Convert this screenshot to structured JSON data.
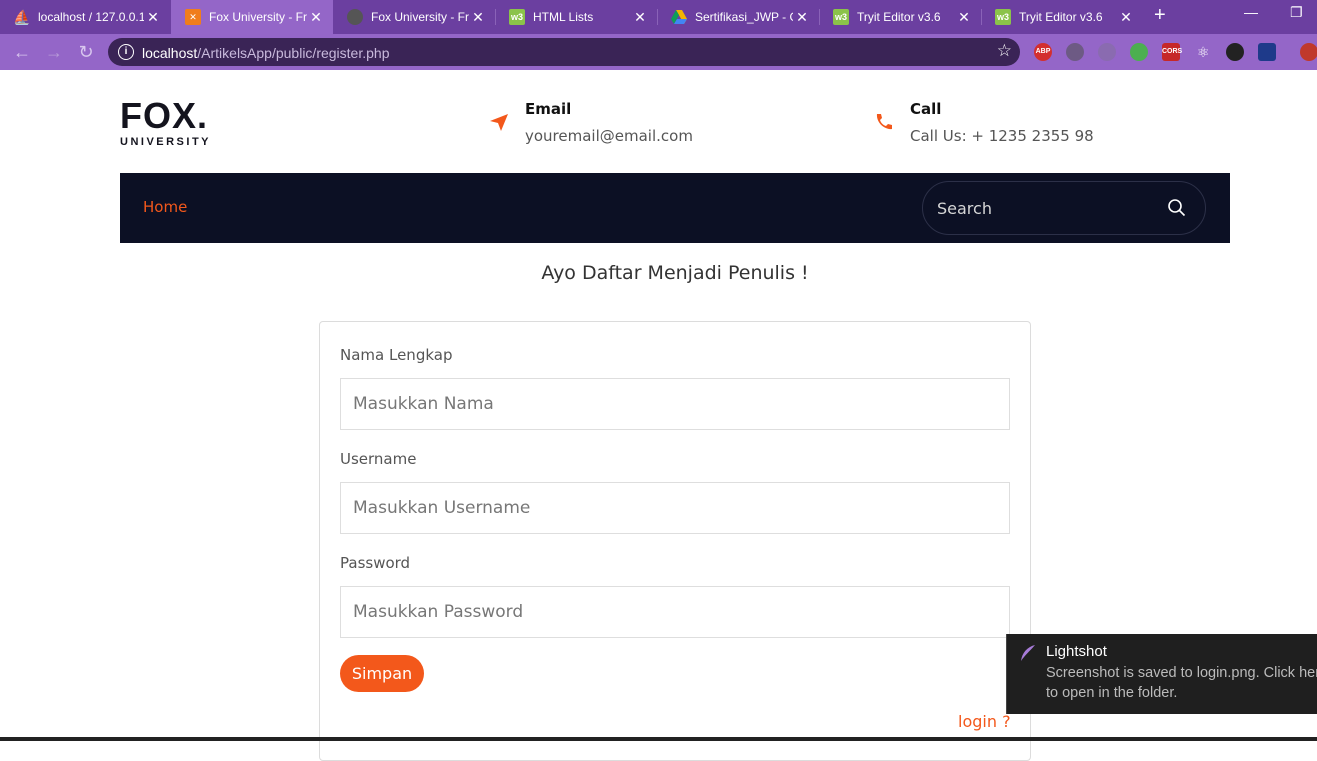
{
  "browser": {
    "tabs": [
      {
        "title": "localhost / 127.0.0.1",
        "icon": "phpmyadmin-icon",
        "active": false
      },
      {
        "title": "Fox University - Free",
        "icon": "xampp-icon",
        "active": true
      },
      {
        "title": "Fox University - Free",
        "icon": "globe-icon",
        "active": false
      },
      {
        "title": "HTML Lists",
        "icon": "w3schools-icon",
        "active": false
      },
      {
        "title": "Sertifikasi_JWP - Google Drive",
        "icon": "google-drive-icon",
        "active": false
      },
      {
        "title": "Tryit Editor v3.6",
        "icon": "w3schools-icon",
        "active": false
      },
      {
        "title": "Tryit Editor v3.6",
        "icon": "w3schools-icon",
        "active": false
      }
    ],
    "url_host": "localhost",
    "url_path": "/ArtikelsApp/public/register.php",
    "extensions": [
      "ABP",
      "",
      "",
      "",
      "CORS",
      "",
      "",
      "",
      ""
    ]
  },
  "site": {
    "logo_main": "FOX.",
    "logo_sub": "UNIVERSITY",
    "email_label": "Email",
    "email_value": "youremail@email.com",
    "call_label": "Call",
    "call_value": "Call Us: + 1235 2355 98",
    "nav_home": "Home",
    "search_placeholder": "Search"
  },
  "form": {
    "heading": "Ayo Daftar Menjadi Penulis !",
    "name_label": "Nama Lengkap",
    "name_placeholder": "Masukkan Nama",
    "username_label": "Username",
    "username_placeholder": "Masukkan Username",
    "password_label": "Password",
    "password_placeholder": "Masukkan Password",
    "submit_label": "Simpan",
    "login_link": "login ?"
  },
  "toast": {
    "title": "Lightshot",
    "message_line1": "Screenshot is saved to login.png. Click here",
    "message_line2": "to open in the folder."
  },
  "colors": {
    "accent": "#f3581b",
    "nav_bg": "#0c1024",
    "browser_tabbar": "#6b3fa0"
  }
}
